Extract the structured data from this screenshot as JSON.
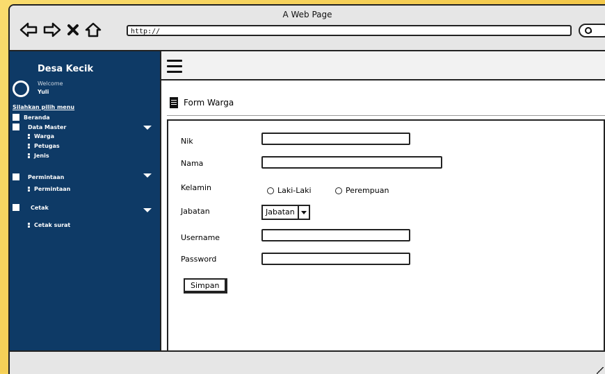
{
  "browser": {
    "page_title": "A Web Page",
    "url": "http://"
  },
  "sidebar": {
    "brand": "Desa Kecik",
    "welcome": "Welcome",
    "user": "Yuli",
    "prompt": "Silahkan pilih menu",
    "items": [
      {
        "label": "Beranda",
        "icon": "external-link-icon"
      },
      {
        "label": "Data Master",
        "icon": "box-icon"
      },
      {
        "label": "Warga",
        "icon": "dots-icon"
      },
      {
        "label": "Petugas",
        "icon": "dots-icon"
      },
      {
        "label": "Jenis",
        "icon": "dots-icon"
      },
      {
        "label": "Permintaan",
        "icon": "edit-icon"
      },
      {
        "label": "Permintaan",
        "icon": "dots-icon"
      },
      {
        "label": "Cetak",
        "icon": "edit-icon"
      },
      {
        "label": "Cetak surat",
        "icon": "dots-icon"
      }
    ]
  },
  "form": {
    "title": "Form Warga",
    "nik_label": "Nik",
    "nama_label": "Nama",
    "kelamin_label": "Kelamin",
    "kelamin_options": [
      "Laki-Laki",
      "Perempuan"
    ],
    "jabatan_label": "Jabatan",
    "jabatan_selected": "Jabatan",
    "username_label": "Username",
    "password_label": "Password",
    "submit_label": "Simpan"
  }
}
